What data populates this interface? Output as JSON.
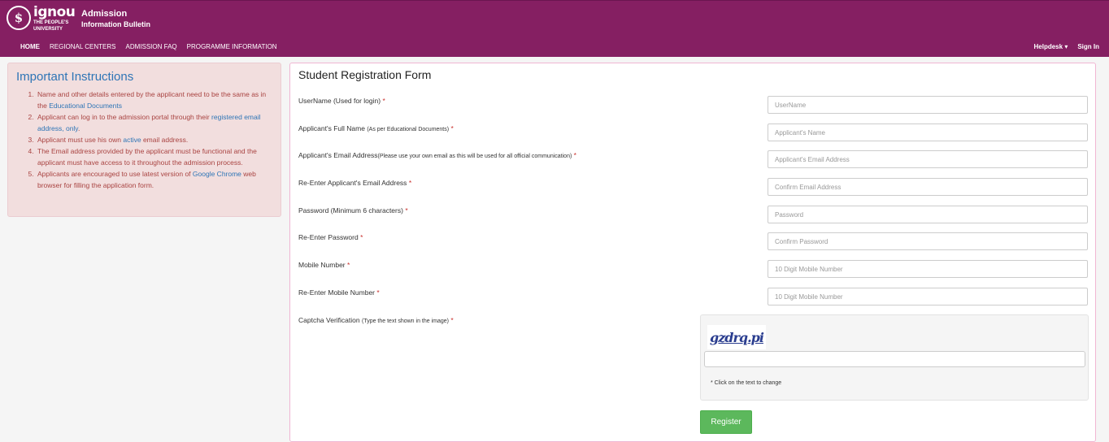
{
  "header": {
    "logo_word": "ignou",
    "logo_sub_1": "THE PEOPLE'S",
    "logo_sub_2": "UNIVERSITY",
    "title_1": "Admission",
    "title_2": "Information Bulletin",
    "nav_left": [
      "HOME",
      "REGIONAL CENTERS",
      "ADMISSION FAQ",
      "PROGRAMME INFORMATION"
    ],
    "helpdesk": "Helpdesk",
    "signin": "Sign In",
    "brand_color": "#851f62"
  },
  "instructions": {
    "title": "Important Instructions",
    "item1_a": "Name and other details entered by the applicant need to be the same as in the ",
    "item1_b": "Educational Documents",
    "item2_a": "Applicant can log in to the admission portal through their ",
    "item2_b": "registered email address, only",
    "item2_c": ".",
    "item3_a": "Applicant must use his own ",
    "item3_b": "active",
    "item3_c": " email address.",
    "item4": "The Email address provided by the applicant must be functional and the applicant must have access to it throughout the admission process.",
    "item5_a": "Applicants are encouraged to use latest version of ",
    "item5_b": "Google Chrome",
    "item5_c": " web browser for filling the application form."
  },
  "form": {
    "title": "Student Registration Form",
    "fields": [
      {
        "label": "UserName (Used for login)",
        "note": "",
        "placeholder": "UserName"
      },
      {
        "label": "Applicant's Full Name",
        "note": "(As per Educational Documents)",
        "placeholder": "Applicant's Name"
      },
      {
        "label": "Applicant's Email Address",
        "note": "(Please use your own email as this will be used for all official communication)",
        "placeholder": "Applicant's Email Address"
      },
      {
        "label": "Re-Enter Applicant's Email Address",
        "note": "",
        "placeholder": "Confirm Email Address"
      },
      {
        "label": "Password (Minimum 6 characters)",
        "note": "",
        "placeholder": "Password"
      },
      {
        "label": "Re-Enter Password",
        "note": "",
        "placeholder": "Confirm Password"
      },
      {
        "label": "Mobile Number",
        "note": "",
        "placeholder": "10 Digit Mobile Number"
      },
      {
        "label": "Re-Enter Mobile Number",
        "note": "",
        "placeholder": "10 Digit Mobile Number"
      }
    ],
    "captcha_label": "Captcha Verification",
    "captcha_note": "(Type the text shown in the image)",
    "captcha_text": "gzdrq.pi",
    "captcha_hint": "* Click on the text to change",
    "required_mark": "*",
    "register_label": "Register"
  }
}
